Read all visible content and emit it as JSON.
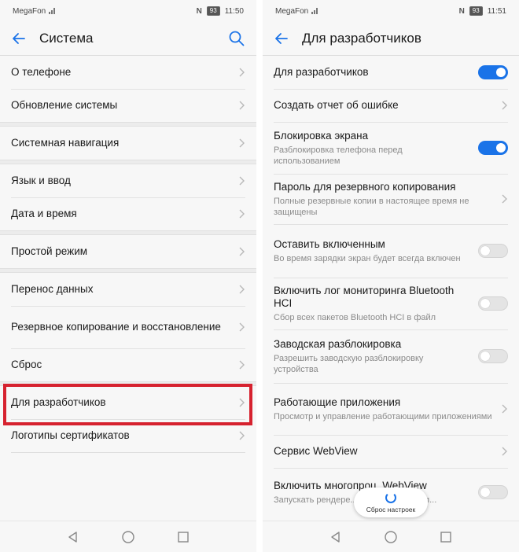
{
  "left": {
    "status": {
      "carrier": "MegaFon",
      "battery": "93",
      "time": "11:50"
    },
    "title": "Система",
    "groups": [
      {
        "items": [
          {
            "label": "О телефоне"
          },
          {
            "label": "Обновление системы"
          }
        ]
      },
      {
        "items": [
          {
            "label": "Системная навигация"
          }
        ]
      },
      {
        "items": [
          {
            "label": "Язык и ввод"
          },
          {
            "label": "Дата и время"
          }
        ]
      },
      {
        "items": [
          {
            "label": "Простой режим"
          }
        ]
      },
      {
        "items": [
          {
            "label": "Перенос данных"
          },
          {
            "label": "Резервное копирование и восстановление"
          },
          {
            "label": "Сброс"
          }
        ]
      },
      {
        "items": [
          {
            "label": "Для разработчиков"
          },
          {
            "label": "Логотипы сертификатов"
          }
        ]
      }
    ]
  },
  "right": {
    "status": {
      "carrier": "MegaFon",
      "battery": "93",
      "time": "11:51"
    },
    "title": "Для разработчиков",
    "items": [
      {
        "title": "Для разработчиков",
        "control": "toggle-on"
      },
      {
        "title": "Создать отчет об ошибке",
        "control": "chevron"
      },
      {
        "title": "Блокировка экрана",
        "subtitle": "Разблокировка телефона перед использованием",
        "control": "toggle-on"
      },
      {
        "title": "Пароль для резервного копирования",
        "subtitle": "Полные резервные копии в настоящее время не защищены",
        "control": "chevron"
      },
      {
        "title": "Оставить включенным",
        "subtitle": "Во время зарядки экран будет всегда включен",
        "control": "toggle-off"
      },
      {
        "title": "Включить лог мониторинга Bluetooth HCI",
        "subtitle": "Сбор всех пакетов Bluetooth HCI в файл",
        "control": "toggle-off"
      },
      {
        "title": "Заводская разблокировка",
        "subtitle": "Разрешить заводскую разблокировку устройства",
        "control": "toggle-off"
      },
      {
        "title": "Работающие приложения",
        "subtitle": "Просмотр и управление работающими приложениями",
        "control": "chevron"
      },
      {
        "title": "Сервис WebView",
        "control": "chevron"
      },
      {
        "title": "Включить многопроц. WebView",
        "subtitle": "Запускать рендере... изолированном п...",
        "control": "toggle-off"
      }
    ],
    "toast": "Сброс настроек"
  },
  "colors": {
    "accent": "#1a73e8",
    "highlight": "#d6222f"
  },
  "icons": {
    "back": "arrow-left-icon",
    "search": "search-icon",
    "chevron": "chevron-right-icon",
    "nav": [
      "back-triangle-icon",
      "home-circle-icon",
      "recents-square-icon"
    ]
  }
}
